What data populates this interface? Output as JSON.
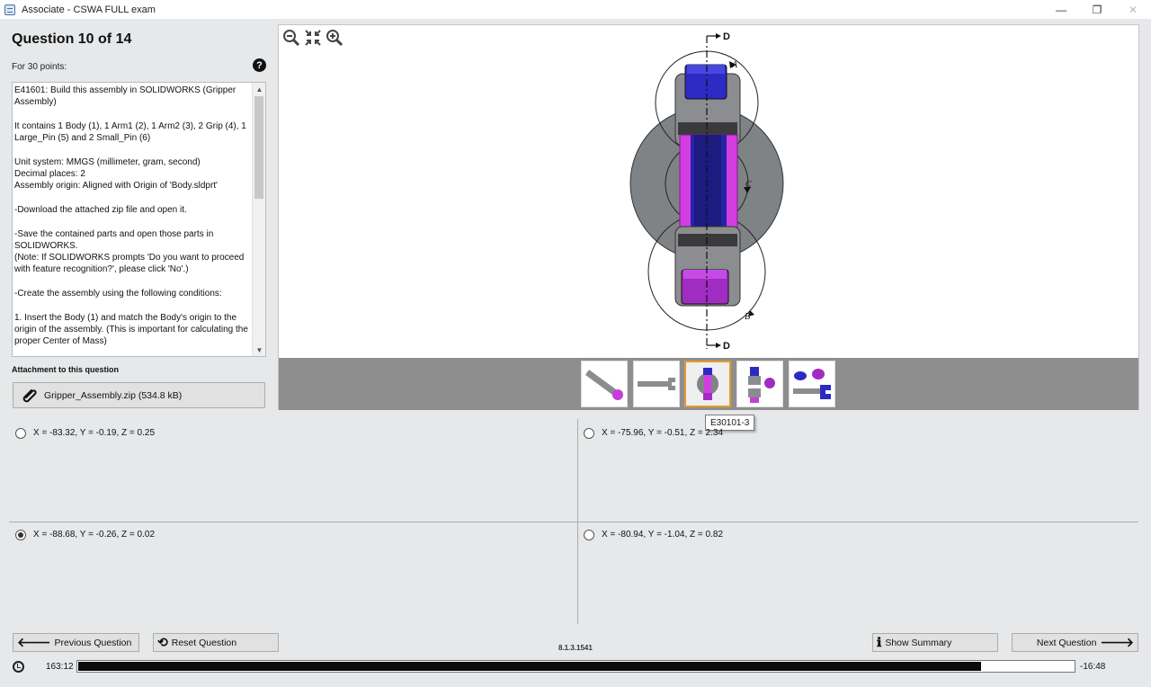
{
  "window": {
    "title": "Associate - CSWA FULL exam",
    "minimize_glyph": "—",
    "restore_glyph": "❐",
    "close_glyph": "✕"
  },
  "question": {
    "title": "Question 10 of 14",
    "points": "For 30 points:",
    "help_glyph": "?",
    "description": "E41601:  Build this assembly in SOLIDWORKS (Gripper Assembly)\n\nIt contains 1 Body (1), 1 Arm1 (2), 1 Arm2 (3), 2 Grip (4), 1 Large_Pin (5) and 2 Small_Pin (6)\n\nUnit system: MMGS (millimeter, gram, second)\nDecimal places: 2\nAssembly origin: Aligned with Origin of 'Body.sldprt'\n\n-Download the attached zip file and open it.\n\n-Save the contained parts and open those parts in SOLIDWORKS.\n(Note: If SOLIDWORKS prompts 'Do you want to proceed with feature recognition?', please click 'No'.)\n\n-Create the assembly using the following conditions:\n\n  1. Insert the Body (1) and match the Body's origin to the origin of the assembly. (This is important for calculating the proper Center of Mass)"
  },
  "attachment": {
    "label": "Attachment to this question",
    "file": "Gripper_Assembly.zip (534.8 kB)",
    "icon": "paperclip-icon"
  },
  "viewer": {
    "tools": [
      "zoom-out-icon",
      "fit-icon",
      "zoom-in-icon"
    ],
    "labels": {
      "top": "D",
      "bottom": "D",
      "a": "A",
      "b": "B",
      "c": "C"
    },
    "thumbnails_count": 5,
    "active_thumbnail": 3,
    "tooltip": "E30101-3"
  },
  "answers": [
    {
      "text": "X = -83.32, Y = -0.19, Z = 0.25",
      "selected": false
    },
    {
      "text": "X = -75.96, Y = -0.51, Z = 2.34",
      "selected": false
    },
    {
      "text": "X = -88.68, Y = -0.26, Z = 0.02",
      "selected": true
    },
    {
      "text": "X = -80.94, Y = -1.04, Z = 0.82",
      "selected": false
    }
  ],
  "nav": {
    "previous": "Previous Question",
    "reset": "Reset Question",
    "summary": "Show Summary",
    "next": "Next Question"
  },
  "version": "8.1.3.1541",
  "timer": {
    "elapsed": "163:12",
    "remaining": "-16:48",
    "progress": 0.907
  },
  "colors": {
    "accent_active_thumb": "#e59a2f",
    "blue_part": "#2727b8",
    "magenta_part": "#d23ee0",
    "grey_part": "#808386"
  }
}
